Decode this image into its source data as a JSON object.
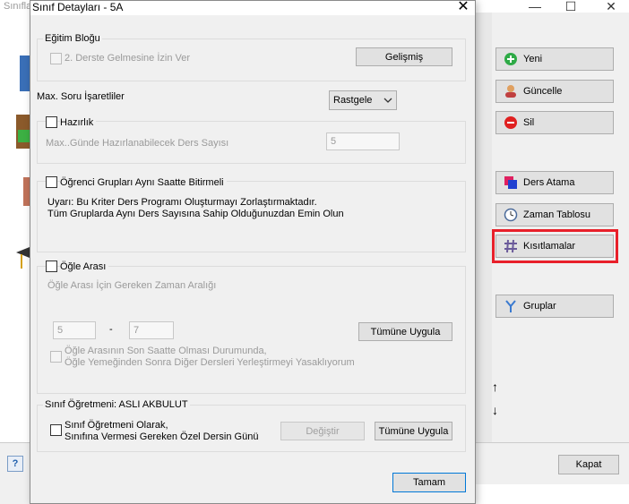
{
  "background_window": {
    "title": "Sınıfla",
    "controls": {
      "minimize": "—",
      "maximize": "☐",
      "close": "✕"
    },
    "buttons": [
      {
        "label": "Yeni",
        "icon": "plus-icon"
      },
      {
        "label": "Güncelle",
        "icon": "user-edit-icon"
      },
      {
        "label": "Sil",
        "icon": "minus-icon"
      },
      {
        "label": "Ders Atama",
        "icon": "squares-icon"
      },
      {
        "label": "Zaman Tablosu",
        "icon": "clock-icon"
      },
      {
        "label": "Kısıtlamalar",
        "icon": "hash-icon"
      },
      {
        "label": "Gruplar",
        "icon": "branch-icon"
      }
    ],
    "arrow_up": "↑",
    "arrow_down": "↓",
    "help_label": "?",
    "close_button": "Kapat",
    "highlight_color": "#e8202a"
  },
  "dialog": {
    "title": "Sınıf Detayları - 5A",
    "close": "✕",
    "egitim_blogu": {
      "title": "Eğitim Bloğu",
      "checkbox_label": "2. Derste Gelmesine İzin Ver",
      "button": "Gelişmiş"
    },
    "max_soru": {
      "label": "Max. Soru İşaretliler",
      "value": "Rastgele"
    },
    "hazirlik": {
      "checkbox_label": "Hazırlık",
      "field_label": "Max..Günde Hazırlanabilecek Ders Sayısı",
      "field_value": "5"
    },
    "ogrenci_gruplari": {
      "checkbox_label": "Öğrenci Grupları Aynı Saatte Bitirmeli",
      "warning_line1": "Uyarı: Bu Kriter Ders Programı Oluşturmayı Zorlaştırmaktadır.",
      "warning_line2": "Tüm Gruplarda Aynı Ders Sayısına Sahip Olduğunuzdan Emin Olun"
    },
    "ogle_arasi": {
      "checkbox_label": "Öğle Arası",
      "range_label": "Öğle Arası İçin Gereken Zaman Aralığı",
      "from_value": "5",
      "dash": "-",
      "to_value": "7",
      "apply_button": "Tümüne Uygula",
      "last_hour_line1": "Öğle Arasının Son Saatte Olması Durumunda,",
      "last_hour_line2": "Öğle Yemeğinden Sonra Diğer Dersleri Yerleştirmeyi Yasaklıyorum"
    },
    "sinif_ogretmeni": {
      "title": "Sınıf Öğretmeni: ASLI AKBULUT",
      "checkbox_line1": "Sınıf Öğretmeni Olarak,",
      "checkbox_line2": "Sınıfına Vermesi Gereken Özel Dersin Günü",
      "change_button": "Değiştir",
      "apply_button": "Tümüne Uygula"
    },
    "ok_button": "Tamam"
  }
}
